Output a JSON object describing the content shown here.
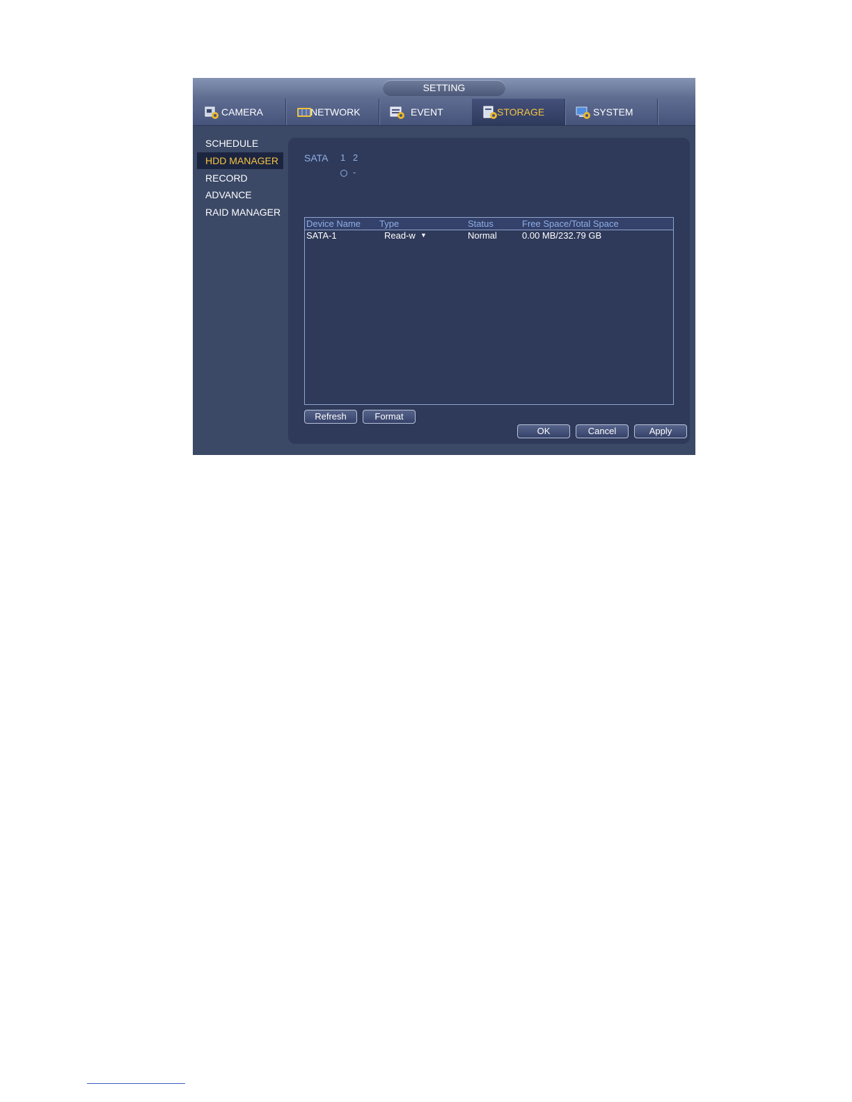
{
  "window": {
    "title": "SETTING"
  },
  "tabs": [
    {
      "label": "CAMERA",
      "icon": "camera-gear-icon"
    },
    {
      "label": "NETWORK",
      "icon": "network-icon"
    },
    {
      "label": "EVENT",
      "icon": "event-gear-icon"
    },
    {
      "label": "STORAGE",
      "icon": "storage-gear-icon",
      "active": true
    },
    {
      "label": "SYSTEM",
      "icon": "system-gear-icon"
    }
  ],
  "sidebar": {
    "items": [
      {
        "label": "SCHEDULE"
      },
      {
        "label": "HDD MANAGER",
        "active": true
      },
      {
        "label": "RECORD"
      },
      {
        "label": "ADVANCE"
      },
      {
        "label": "RAID MANAGER"
      }
    ]
  },
  "sata": {
    "label": "SATA",
    "ports": [
      "1",
      "2"
    ],
    "port2_status": "-"
  },
  "table": {
    "columns": [
      "Device Name",
      "Type",
      "Status",
      "Free Space/Total Space"
    ],
    "rows": [
      {
        "device": "SATA-1",
        "type": "Read-w",
        "status": "Normal",
        "space": "0.00 MB/232.79 GB"
      }
    ]
  },
  "buttons": {
    "refresh": "Refresh",
    "format": "Format",
    "ok": "OK",
    "cancel": "Cancel",
    "apply": "Apply"
  },
  "colors": {
    "accent": "#f5c542",
    "label_blue": "#8fb0e6",
    "panel": "#2f3a5a",
    "window": "#3b4866"
  }
}
